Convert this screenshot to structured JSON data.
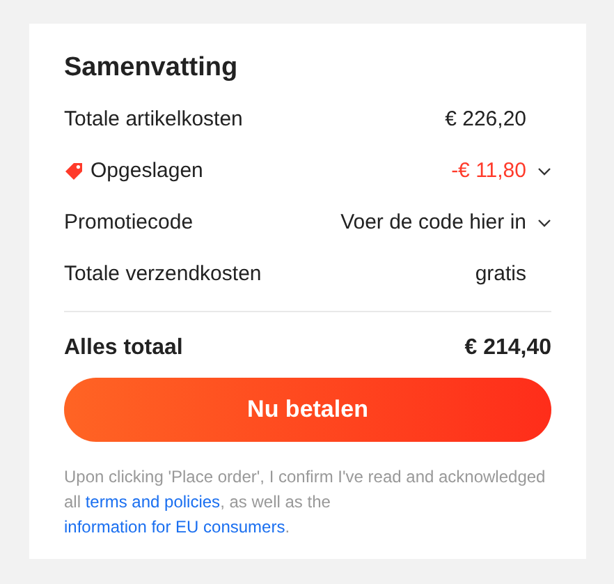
{
  "summary": {
    "title": "Samenvatting",
    "rows": [
      {
        "kind": "plain",
        "label": "Totale artikelkosten",
        "value": "€ 226,20"
      },
      {
        "kind": "savings",
        "label": "Opgeslagen",
        "value": "-€ 11,80",
        "expanded": false
      },
      {
        "kind": "dropdown",
        "label": "Promotiecode",
        "value": "Voer de code hier in",
        "expanded": false
      },
      {
        "kind": "plain",
        "label": "Totale verzendkosten",
        "value": "gratis"
      }
    ],
    "total": {
      "label": "Alles totaal",
      "value": "€ 214,40"
    },
    "pay_button": "Nu betalen",
    "disclaimer": [
      {
        "kind": "text",
        "text": "Upon clicking 'Place order', I confirm I've read and acknowledged all "
      },
      {
        "kind": "link",
        "text": "terms and policies"
      },
      {
        "kind": "text",
        "text": ", as well as the "
      },
      {
        "kind": "link",
        "text": "information for EU consumers"
      },
      {
        "kind": "text",
        "text": "."
      }
    ]
  }
}
